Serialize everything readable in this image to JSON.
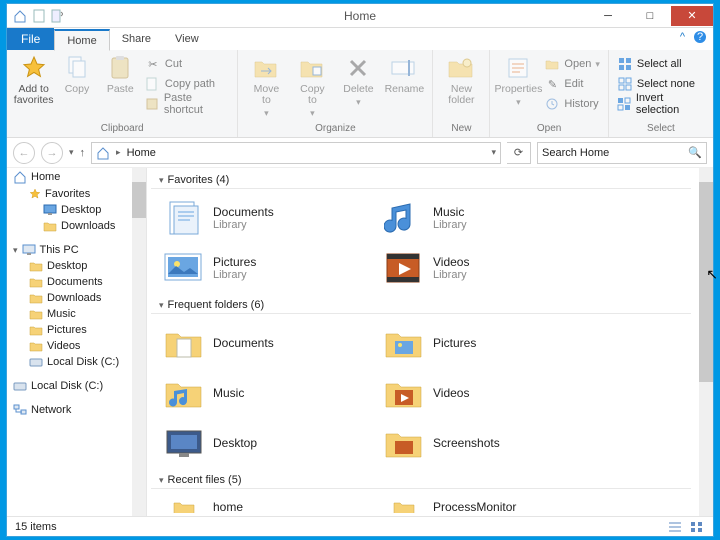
{
  "window": {
    "title": "Home"
  },
  "tabs": {
    "file": "File",
    "home": "Home",
    "share": "Share",
    "view": "View"
  },
  "ribbon": {
    "clipboard": {
      "label": "Clipboard",
      "addfav": "Add to\nfavorites",
      "copy": "Copy",
      "paste": "Paste",
      "cut": "Cut",
      "copypath": "Copy path",
      "pasteshort": "Paste shortcut"
    },
    "organize": {
      "label": "Organize",
      "moveto": "Move\nto",
      "copyto": "Copy\nto",
      "delete": "Delete",
      "rename": "Rename"
    },
    "new": {
      "label": "New",
      "newfolder": "New\nfolder"
    },
    "open": {
      "label": "Open",
      "properties": "Properties",
      "open": "Open",
      "edit": "Edit",
      "history": "History"
    },
    "select": {
      "label": "Select",
      "all": "Select all",
      "none": "Select none",
      "invert": "Invert selection"
    }
  },
  "nav": {
    "location": "Home",
    "search_placeholder": "Search Home"
  },
  "tree": {
    "home": "Home",
    "favorites": "Favorites",
    "desktop": "Desktop",
    "downloads": "Downloads",
    "thispc": "This PC",
    "music": "Music",
    "pictures": "Pictures",
    "videos": "Videos",
    "documents": "Documents",
    "localdisk": "Local Disk (C:)",
    "network": "Network"
  },
  "sections": {
    "favorites": {
      "title": "Favorites (4)",
      "items": [
        {
          "name": "Documents",
          "sub": "Library",
          "kind": "doc"
        },
        {
          "name": "Music",
          "sub": "Library",
          "kind": "music"
        },
        {
          "name": "Pictures",
          "sub": "Library",
          "kind": "pic"
        },
        {
          "name": "Videos",
          "sub": "Library",
          "kind": "vid"
        }
      ]
    },
    "frequent": {
      "title": "Frequent folders (6)",
      "items": [
        {
          "name": "Documents",
          "kind": "fdoc"
        },
        {
          "name": "Pictures",
          "kind": "fpic"
        },
        {
          "name": "Music",
          "kind": "fmus"
        },
        {
          "name": "Videos",
          "kind": "fvid"
        },
        {
          "name": "Desktop",
          "kind": "desk"
        },
        {
          "name": "Screenshots",
          "kind": "fss"
        }
      ]
    },
    "recent": {
      "title": "Recent files (5)",
      "items": [
        {
          "name": "home",
          "kind": "f"
        },
        {
          "name": "ProcessMonitor",
          "kind": "f"
        }
      ]
    }
  },
  "status": {
    "count": "15 items"
  }
}
